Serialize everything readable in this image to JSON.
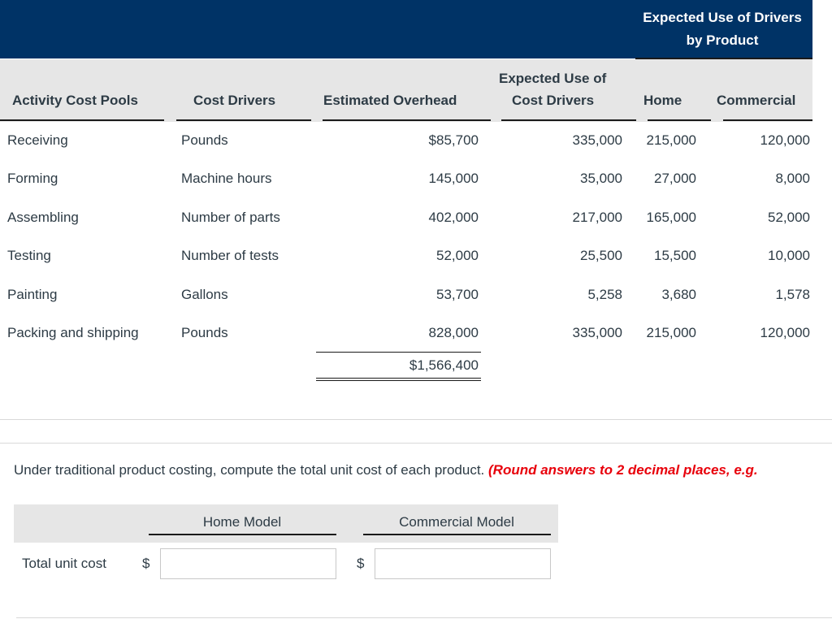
{
  "table": {
    "group_header": "Expected Use of Drivers by Product",
    "columns": {
      "activity": "Activity Cost Pools",
      "drivers": "Cost Drivers",
      "overhead": "Estimated Overhead",
      "expected_line1": "Expected Use of",
      "expected_line2": "Cost Drivers",
      "home": "Home",
      "commercial": "Commercial"
    },
    "rows": [
      {
        "activity": "Receiving",
        "driver": "Pounds",
        "overhead": "$85,700",
        "expected": "335,000",
        "home": "215,000",
        "commercial": "120,000"
      },
      {
        "activity": "Forming",
        "driver": "Machine hours",
        "overhead": "145,000",
        "expected": "35,000",
        "home": "27,000",
        "commercial": "8,000"
      },
      {
        "activity": "Assembling",
        "driver": "Number of parts",
        "overhead": "402,000",
        "expected": "217,000",
        "home": "165,000",
        "commercial": "52,000"
      },
      {
        "activity": "Testing",
        "driver": "Number of tests",
        "overhead": "52,000",
        "expected": "25,500",
        "home": "15,500",
        "commercial": "10,000"
      },
      {
        "activity": "Painting",
        "driver": "Gallons",
        "overhead": "53,700",
        "expected": "5,258",
        "home": "3,680",
        "commercial": "1,578"
      },
      {
        "activity": "Packing and shipping",
        "driver": "Pounds",
        "overhead": "828,000",
        "expected": "335,000",
        "home": "215,000",
        "commercial": "120,000"
      }
    ],
    "total_overhead": "$1,566,400"
  },
  "question": {
    "text": "Under traditional product costing, compute the total unit cost of each product.",
    "hint": "(Round answers to 2 decimal places, e.g."
  },
  "answer": {
    "col_home": "Home Model",
    "col_commercial": "Commercial Model",
    "row_label": "Total unit cost",
    "currency": "$",
    "home_value": "",
    "commercial_value": ""
  }
}
